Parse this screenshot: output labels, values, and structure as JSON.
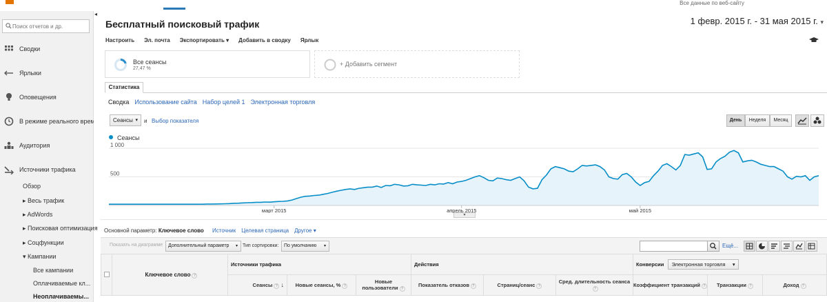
{
  "header": {
    "site_label": "Все данные по веб-сайту"
  },
  "sidebar": {
    "search_placeholder": "Поиск отчетов и др.",
    "items": [
      {
        "label": "Сводки",
        "icon": "dashboard-grid-icon"
      },
      {
        "label": "Ярлыки",
        "icon": "shortcut-arrow-icon"
      },
      {
        "label": "Оповещения",
        "icon": "lightbulb-icon"
      },
      {
        "label": "В режиме реального времени",
        "icon": "clock-icon"
      },
      {
        "label": "Аудитория",
        "icon": "audience-icon"
      },
      {
        "label": "Источники трафика",
        "icon": "traffic-sources-icon"
      }
    ],
    "sub": {
      "overview": "Обзор",
      "all_traffic": "Весь трафик",
      "adwords": "AdWords",
      "seo": "Поисковая оптимизация",
      "social": "Соцфункции",
      "campaigns": "Кампании",
      "all_campaigns": "Все кампании",
      "paid": "Оплачиваемые кл...",
      "organic": "Неоплачиваемы..."
    }
  },
  "report": {
    "title": "Бесплатный поисковый трафик",
    "date_range": "1 февр. 2015 г. - 31 мая 2015 г.",
    "toolbar": [
      "Настроить",
      "Эл. почта",
      "Экспортировать ▾",
      "Добавить в сводку",
      "Ярлык"
    ]
  },
  "segments": {
    "seg1_title": "Все сеансы",
    "seg1_pct": "27,47 %",
    "add_label": "+ Добавить сегмент"
  },
  "tabs": {
    "main": "Статистика",
    "sub": [
      "Сводка",
      "Использование сайта",
      "Набор целей 1",
      "Электронная торговля"
    ]
  },
  "chart_controls": {
    "metric": "Сеансы",
    "and": "и",
    "pick_metric": "Выбор показателя",
    "periods": [
      "День",
      "Неделя",
      "Месяц"
    ]
  },
  "chart_data": {
    "type": "area",
    "series": [
      {
        "name": "Сеансы",
        "color": "#058dc7"
      }
    ],
    "y_ticks": [
      "1 000",
      "500"
    ],
    "ylim": [
      0,
      1000
    ],
    "x_ticks": [
      "март 2015",
      "апрель 2015",
      "май 2015"
    ],
    "values": [
      22,
      22,
      22,
      22,
      22,
      22,
      22,
      22,
      22,
      22,
      22,
      22,
      22,
      22,
      22,
      22,
      22,
      22,
      22,
      22,
      22,
      22,
      25,
      25,
      26,
      28,
      30,
      32,
      38,
      40,
      45,
      48,
      50,
      55,
      56,
      60,
      58,
      64,
      70,
      72,
      80,
      95,
      120,
      145,
      160,
      165,
      175,
      180,
      195,
      210,
      230,
      250,
      265,
      280,
      290,
      280,
      300,
      310,
      320,
      320,
      340,
      315,
      350,
      345,
      370,
      360,
      340,
      345,
      370,
      360,
      355,
      350,
      370,
      360,
      380,
      375,
      400,
      380,
      410,
      420,
      440,
      470,
      500,
      520,
      485,
      440,
      430,
      480,
      470,
      450,
      440,
      470,
      500,
      430,
      320,
      290,
      300,
      450,
      530,
      640,
      680,
      660,
      640,
      600,
      590,
      640,
      700,
      690,
      700,
      710,
      680,
      620,
      500,
      470,
      460,
      540,
      560,
      500,
      410,
      350,
      400,
      420,
      520,
      600,
      700,
      730,
      680,
      620,
      700,
      890,
      880,
      900,
      920,
      850,
      630,
      640,
      760,
      820,
      860,
      930,
      960,
      920,
      760,
      780,
      790,
      760,
      720,
      700,
      680,
      680,
      640,
      600,
      500,
      460,
      510,
      500,
      520,
      440,
      500,
      520
    ]
  },
  "primary_dim": {
    "label": "Основной параметр:",
    "current": "Ключевое слово",
    "options": [
      "Источник",
      "Целевая страница",
      "Другое ▾"
    ]
  },
  "table_controls": {
    "show_on_chart": "Показать на диаграмме",
    "secondary_param": "Дополнительный параметр",
    "sort_type_label": "Тип сортировки:",
    "sort_value": "По умолчанию",
    "more": "Ещё..."
  },
  "table": {
    "col_keyword": "Ключевое слово",
    "groups": {
      "acquisition": "Источники трафика",
      "behavior": "Действия",
      "conversions_label": "Конверсии",
      "conversions_select": "Электронная торговля"
    },
    "headers": [
      "Сеансы",
      "Новые сеансы, %",
      "Новые пользователи",
      "Показатель отказов",
      "Страниц/сеанс",
      "Сред. длительность сеанса",
      "Коэффициент транзакций",
      "Транзакции",
      "Доход"
    ]
  }
}
